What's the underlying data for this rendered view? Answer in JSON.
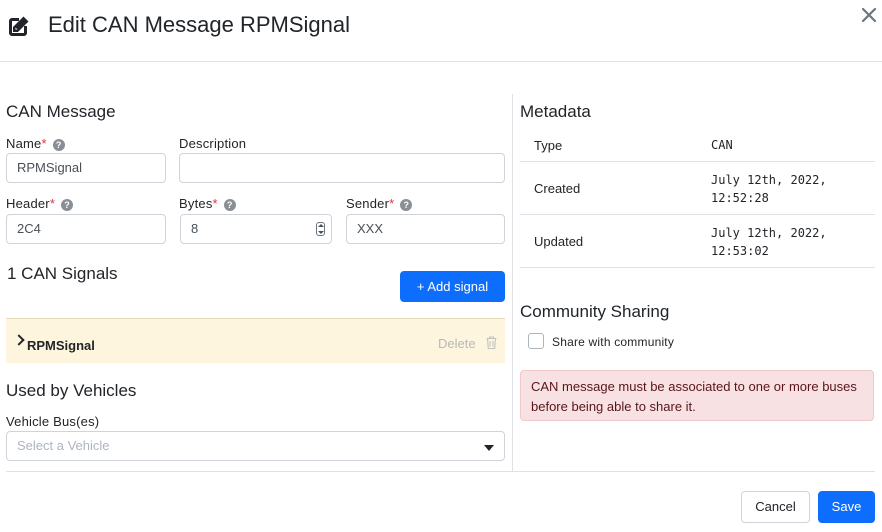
{
  "header": {
    "title": "Edit CAN Message RPMSignal"
  },
  "can_message": {
    "section_title": "CAN Message",
    "name_label": "Name",
    "name_value": "RPMSignal",
    "description_label": "Description",
    "description_value": "",
    "header_label": "Header",
    "header_value": "2C4",
    "bytes_label": "Bytes",
    "bytes_value": "8",
    "sender_label": "Sender",
    "sender_value": "XXX",
    "required_marker": "*",
    "help_glyph": "?"
  },
  "signals": {
    "section_title": "1 CAN Signals",
    "add_button_label": "+  Add signal",
    "items": [
      {
        "name": "RPMSignal",
        "delete_label": "Delete"
      }
    ]
  },
  "vehicles": {
    "section_title": "Used by Vehicles",
    "bus_label": "Vehicle Bus(es)",
    "select_placeholder": "Select a Vehicle"
  },
  "metadata": {
    "section_title": "Metadata",
    "rows": [
      {
        "key": "Type",
        "value": "CAN"
      },
      {
        "key": "Created",
        "value": "July 12th, 2022, 12:52:28"
      },
      {
        "key": "Updated",
        "value": "July 12th, 2022, 12:53:02"
      }
    ]
  },
  "community": {
    "section_title": "Community Sharing",
    "checkbox_label": "Share with community",
    "checked": false,
    "alert_text": "CAN message must be associated to one or more buses before being able to share it."
  },
  "footer": {
    "cancel_label": "Cancel",
    "save_label": "Save"
  },
  "colors": {
    "primary": "#0d6efd",
    "required": "#dc3545",
    "signal_row_bg": "#fdf5dd",
    "alert_bg": "#f8e1e2"
  },
  "icons": {
    "title_icon": "edit-icon",
    "close": "close-icon",
    "help": "help-icon",
    "expand": "chevron-right-icon",
    "delete": "trash-icon",
    "dropdown": "caret-down-icon"
  }
}
